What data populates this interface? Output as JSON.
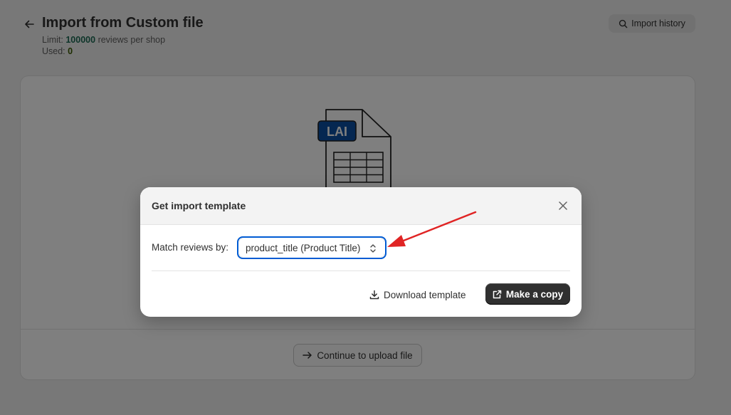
{
  "header": {
    "title": "Import from Custom file",
    "limit_label": "Limit:",
    "limit_value": "100000",
    "limit_suffix": "reviews per shop",
    "used_label": "Used:",
    "used_value": "0",
    "import_history_label": "Import history"
  },
  "card": {
    "file_badge": "LAI",
    "continue_label": "Continue to upload file"
  },
  "modal": {
    "title": "Get import template",
    "match_label": "Match reviews by:",
    "match_selected": "product_title (Product Title)",
    "download_label": "Download template",
    "copy_label": "Make a copy"
  },
  "colors": {
    "accent": "#005bd3",
    "primary_button": "#303030",
    "annotation_arrow": "#e02424",
    "limit_value": "#1d6b54",
    "badge_fill": "#0a4fa3"
  },
  "icons": {
    "back": "arrow-left-icon",
    "history": "search-icon",
    "close": "close-icon",
    "select": "chevron-updown-icon",
    "download": "download-icon",
    "copy": "external-link-icon",
    "continue": "arrow-right-icon"
  }
}
